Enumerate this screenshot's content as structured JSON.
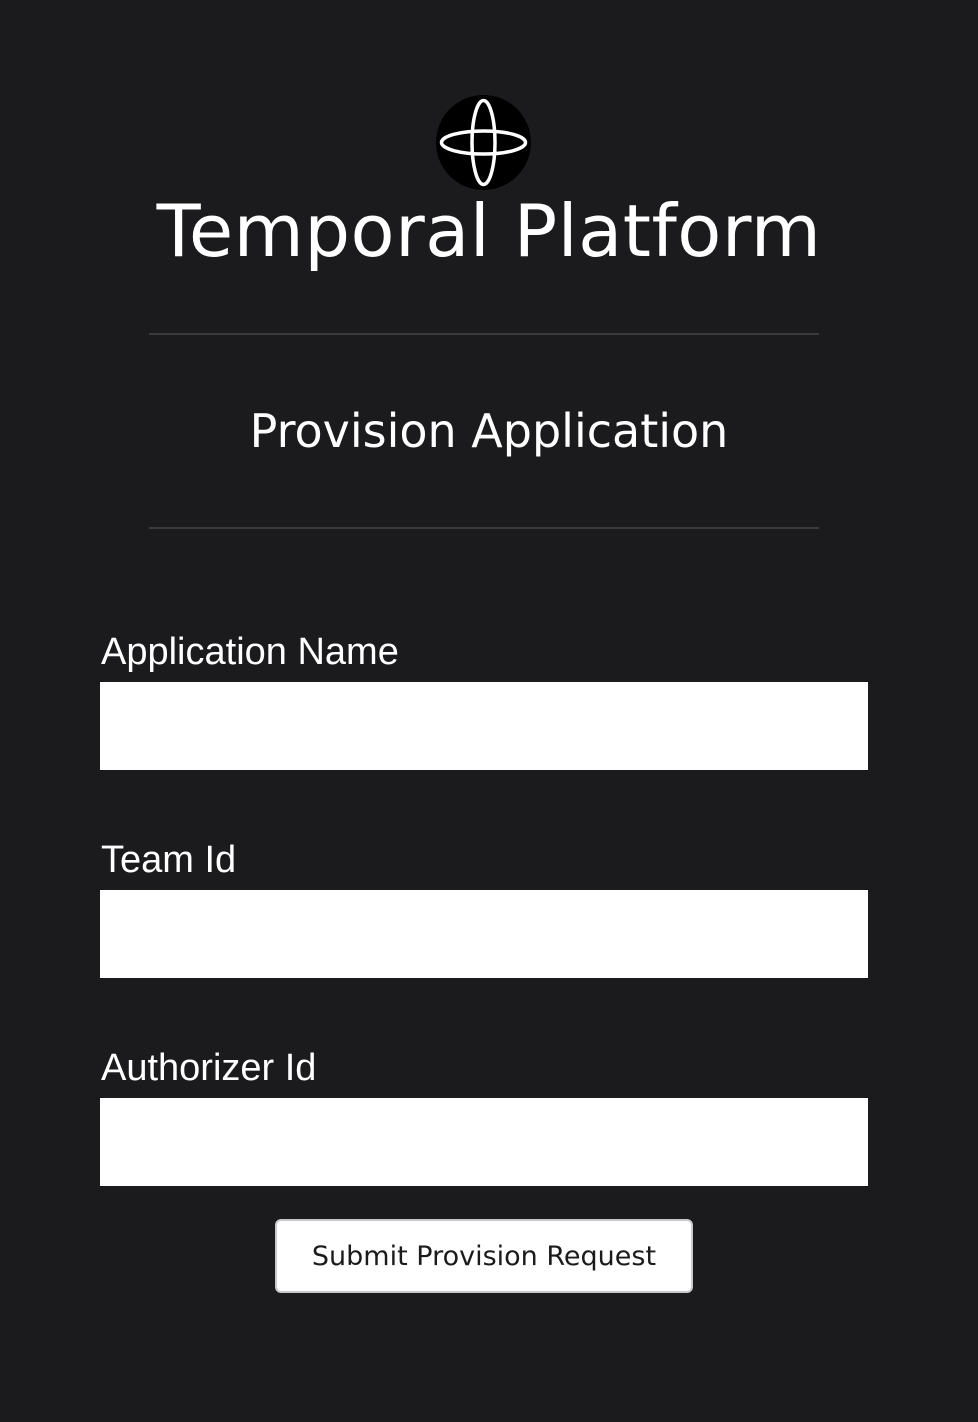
{
  "header": {
    "logo_icon": "temporal-logo-icon",
    "title": "Temporal Platform"
  },
  "page": {
    "title": "Provision Application"
  },
  "form": {
    "fields": [
      {
        "label": "Application Name",
        "value": ""
      },
      {
        "label": "Team Id",
        "value": ""
      },
      {
        "label": "Authorizer Id",
        "value": ""
      }
    ],
    "submit_label": "Submit Provision Request"
  },
  "colors": {
    "background": "#1b1b1d",
    "text": "#ffffff",
    "input_background": "#ffffff",
    "divider": "#3a3a3d"
  }
}
